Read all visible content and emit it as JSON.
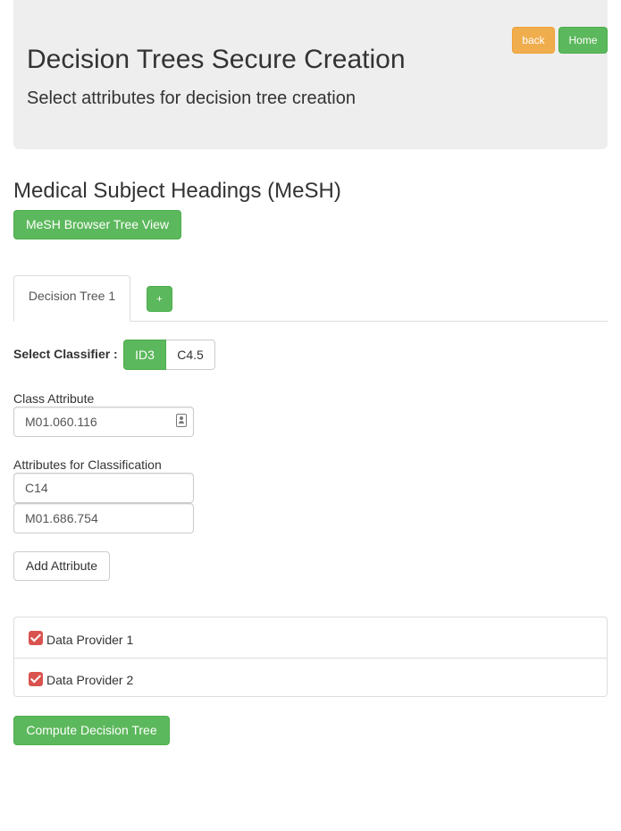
{
  "header": {
    "title": "Decision Trees Secure Creation",
    "subtitle": "Select attributes for decision tree creation",
    "back_label": "back",
    "home_label": "Home"
  },
  "mesh": {
    "title": "Medical Subject Headings (MeSH)",
    "browser_button_label": "MeSH Browser Tree View"
  },
  "tabs": {
    "items": [
      {
        "label": "Decision Tree 1",
        "active": true
      }
    ],
    "add_label": "+"
  },
  "classifier": {
    "label": "Select Classifier :",
    "options": [
      "ID3",
      "C4.5"
    ],
    "selected": "ID3"
  },
  "class_attribute": {
    "label": "Class Attribute",
    "value": "M01.060.116",
    "icon": "contact-card-icon"
  },
  "classification_attributes": {
    "label": "Attributes for Classification",
    "values": [
      "C14",
      "M01.686.754"
    ],
    "add_button_label": "Add Attribute"
  },
  "data_providers": [
    {
      "label": "Data Provider 1",
      "checked": true
    },
    {
      "label": "Data Provider 2",
      "checked": true
    }
  ],
  "compute_button_label": "Compute Decision Tree",
  "colors": {
    "success": "#5cb85c",
    "warning": "#f0ad4e",
    "checkbox": "#d9534f",
    "jumbotron_bg": "#eeeeee"
  }
}
